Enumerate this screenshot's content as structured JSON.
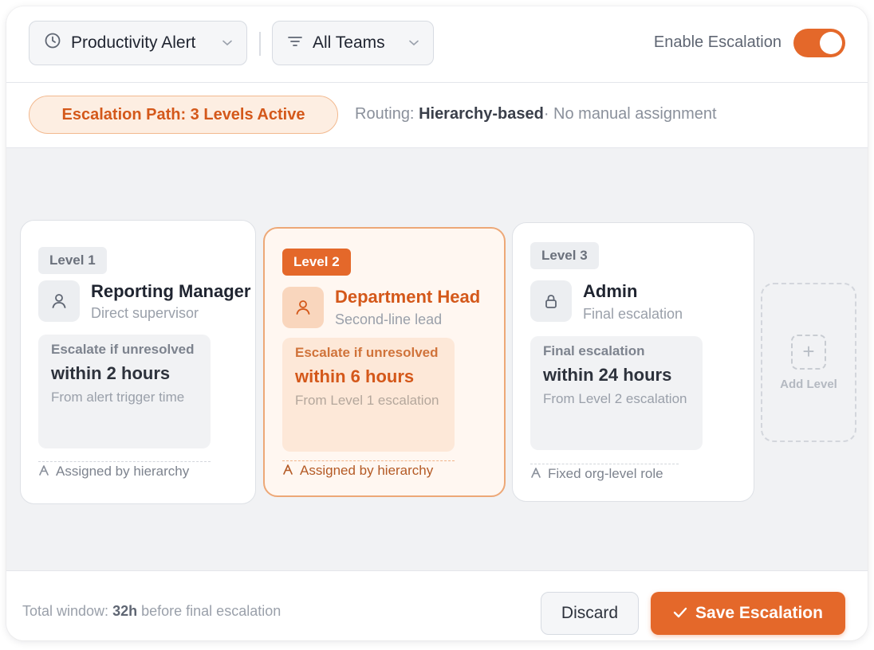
{
  "header": {
    "alert_select": {
      "label": "Productivity Alert",
      "icon": "clock-icon"
    },
    "teams_select": {
      "label": "All Teams",
      "icon": "filter-icon"
    },
    "enable_escalation_label": "Enable Escalation",
    "enable_escalation_on": true
  },
  "info": {
    "path_pill": "Escalation Path: 3 Levels Active",
    "routing_prefix": "Routing:",
    "routing_value": "Hierarchy-based",
    "routing_suffix": "· No manual assignment"
  },
  "levels": [
    {
      "badge": "Level 1",
      "icon": "user-icon",
      "name": "Reporting Manager",
      "subtitle": "Direct supervisor",
      "condition": "Escalate if unresolved",
      "within": "within 2 hours",
      "from": "From alert trigger time",
      "assignment": "Assigned by hierarchy"
    },
    {
      "badge": "Level 2",
      "icon": "user-icon",
      "name": "Department Head",
      "subtitle": "Second-line lead",
      "condition": "Escalate if unresolved",
      "within": "within 6 hours",
      "from": "From Level 1 escalation",
      "assignment": "Assigned by hierarchy"
    },
    {
      "badge": "Level 3",
      "icon": "lock-icon",
      "name": "Admin",
      "subtitle": "Final escalation",
      "condition": "Final escalation",
      "within": "within 24 hours",
      "from": "From Level 2 escalation",
      "assignment": "Fixed org-level role"
    }
  ],
  "add_level_label": "Add Level",
  "footer": {
    "total_prefix": "Total window:",
    "total_value": "32h",
    "total_suffix": "before final escalation",
    "discard_label": "Discard",
    "save_label": "Save Escalation"
  },
  "colors": {
    "accent": "#e4682a",
    "accent_text": "#d4581a",
    "active_card_bg": "#fff7f1"
  }
}
